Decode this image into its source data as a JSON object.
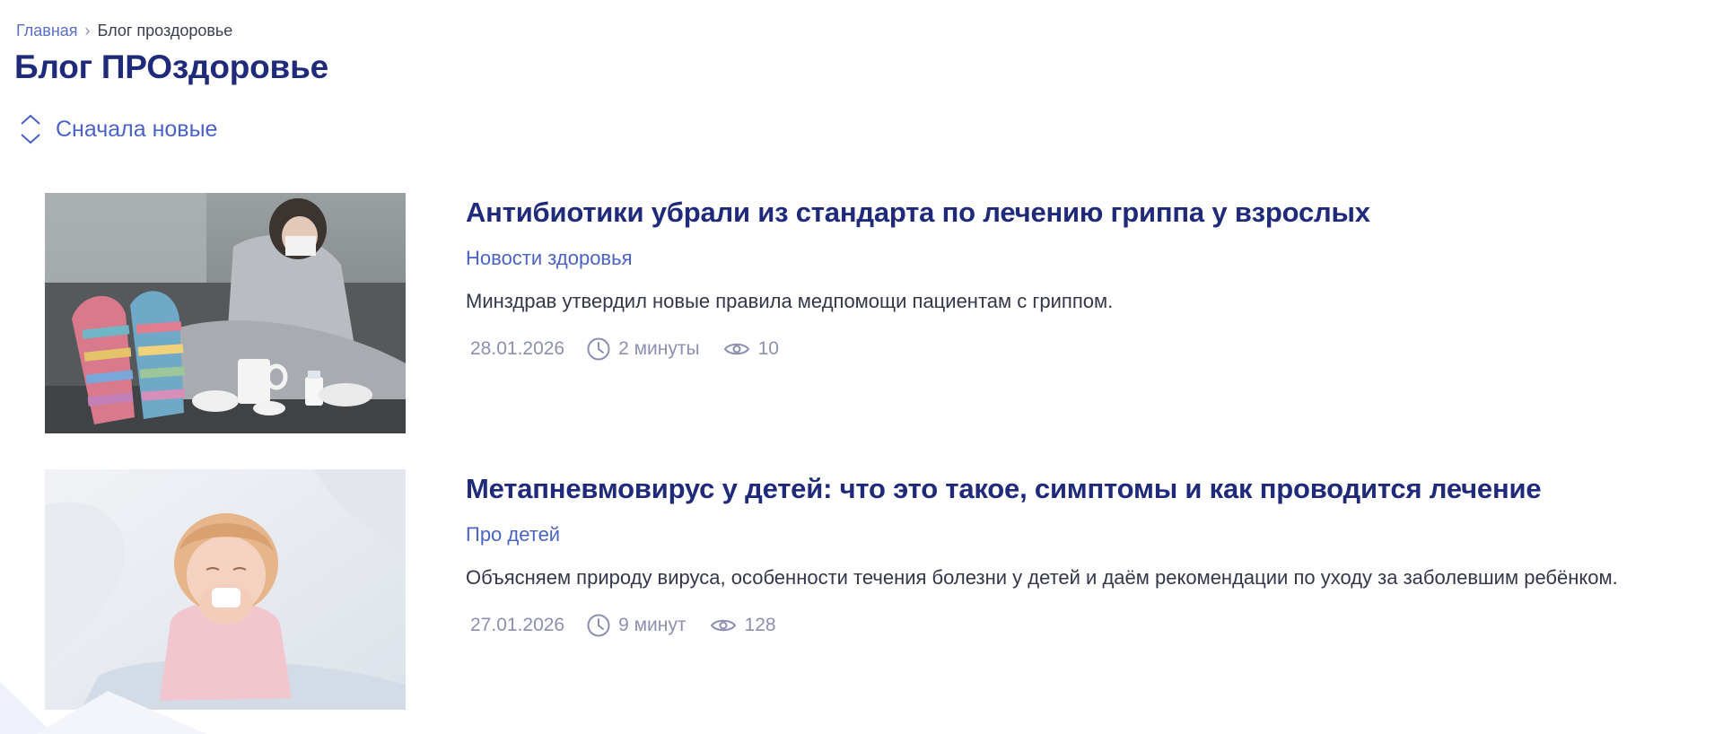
{
  "breadcrumb": {
    "home": "Главная",
    "separator": "›",
    "current": "Блог проздоровье"
  },
  "page": {
    "title": "Блог ПРОздоровье"
  },
  "sort": {
    "label": "Сначала новые",
    "icon": "sort-up-down-icon"
  },
  "colors": {
    "title": "#1f2a7a",
    "accent": "#4a63c7",
    "meta": "#8c90b0"
  },
  "posts": [
    {
      "title": "Антибиотики убрали из стандарта по лечению гриппа у взрослых",
      "tag": "Новости здоровья",
      "excerpt": "Минздрав утвердил новые правила медпомощи пациентам с гриппом.",
      "date": "28.01.2026",
      "read_time": "2 минуты",
      "views": "10",
      "image": "woman-with-socks-and-tissues-photo"
    },
    {
      "title": "Метапневмовирус у детей: что это такое, симптомы и как проводится лечение",
      "tag": "Про детей",
      "excerpt": "Объясняем природу вируса, особенности течения болезни у детей и даём рекомендации по уходу за заболевшим ребёнком.",
      "date": "27.01.2026",
      "read_time": "9 минут",
      "views": "128",
      "image": "sick-child-sneezing-photo"
    }
  ]
}
